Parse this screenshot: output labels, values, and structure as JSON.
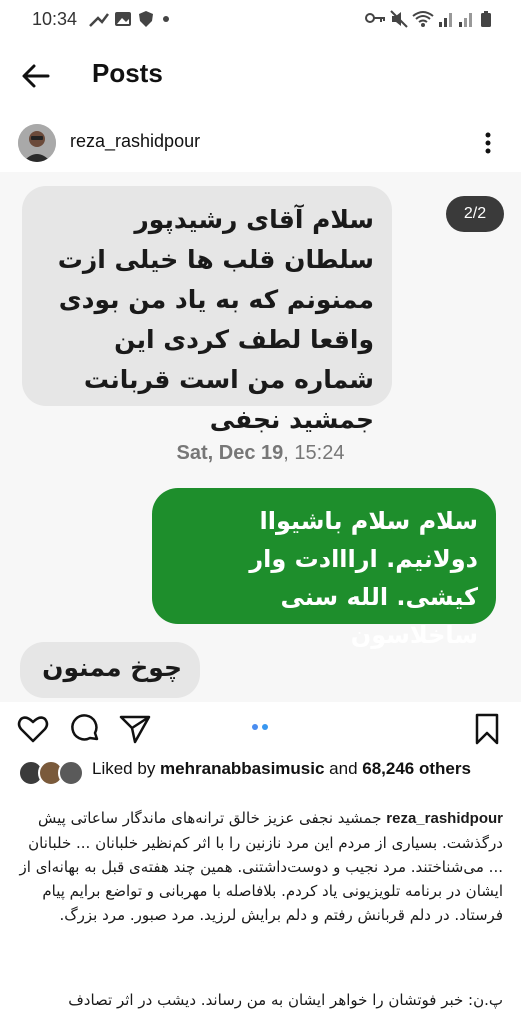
{
  "status_bar": {
    "time": "10:34",
    "icons": [
      "cast-icon",
      "image-icon",
      "shield-icon",
      "dot-icon",
      "key-icon",
      "mute-icon",
      "wifi-icon",
      "signal-icon",
      "signal-icon",
      "battery-icon"
    ]
  },
  "app_bar": {
    "title": "Posts"
  },
  "post": {
    "username": "reza_rashidpour",
    "page_indicator": "2/2",
    "messages": {
      "received_1": "سلام آقای رشیدپور سلطان قلب ها خیلی ازت ممنونم که به یاد من بودی واقعا لطف کردی این شماره من است قربانت جمشید نجفی",
      "date_day": "Sat, Dec 19",
      "date_time": ", 15:24",
      "sent_1": "سلام سلام باشیواا دولانیم. ارااادت وار کیشی. الله سنی ساخلاسون",
      "received_2": "چوخ ممنون"
    },
    "likes": {
      "prefix": "Liked by ",
      "user": "mehranabbasimusic",
      "middle": " and ",
      "count": "68,246",
      "suffix": " others"
    },
    "caption": {
      "user": "reza_rashidpour",
      "text": "جمشید نجفی عزیز خالق ترانه‌های ماندگار ساعاتی پیش درگذشت. بسیاری از مردم این مرد نازنین را با اثر کم‌نظیر خلبانان ... خلبانان ... می‌شناختند. مرد نجیب و دوست‌داشتنی. همین چند هفته‌ی قبل به بهانه‌ای از ایشان در برنامه تلویزیونی یاد کردم. بلافاصله با مهربانی و تواضع برایم پیام فرستاد. در دلم قربانش رفتم و دلم برایش لرزید. مرد صبور. مرد بزرگ.",
      "text_2": "پ.ن: خبر فوتشان را خواهر ایشان به من رساند. دیشب در اثر تصادف"
    },
    "colors": {
      "green_bubble": "#1e8e2c",
      "gray_bubble": "#e6e6e6"
    }
  }
}
